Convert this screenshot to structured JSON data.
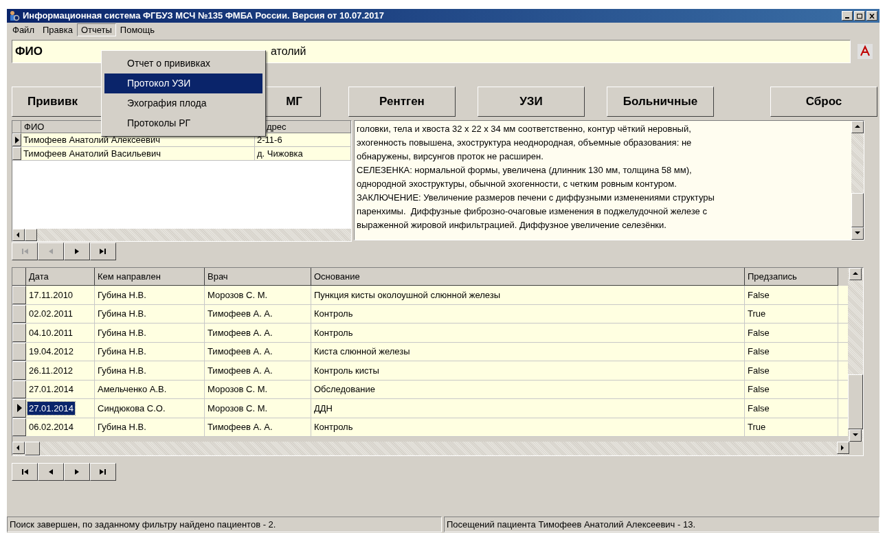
{
  "window": {
    "title": "Информационная система ФГБУЗ МСЧ №135 ФМБА России. Версия от 10.07.2017"
  },
  "menu": [
    {
      "label": "Файл",
      "selected": false
    },
    {
      "label": "Правка",
      "selected": false
    },
    {
      "label": "Отчеты",
      "selected": true
    },
    {
      "label": "Помощь",
      "selected": false
    }
  ],
  "dropdown": [
    {
      "label": "Отчет о прививках",
      "selected": false
    },
    {
      "label": "Протокол УЗИ",
      "selected": true
    },
    {
      "label": "Эхография плода",
      "selected": false
    },
    {
      "label": "Протоколы РГ",
      "selected": false
    }
  ],
  "search": {
    "label": "ФИО",
    "value": "атолий"
  },
  "buttons": [
    "Прививк",
    "МГ",
    "Рентген",
    "УЗИ",
    "Больничные",
    "Сброс"
  ],
  "patients": {
    "columns": [
      "ФИО",
      "дрес"
    ],
    "rows": [
      {
        "cells": [
          "Тимофеев Анатолий Алексеевич",
          "2-11-6"
        ],
        "selected": true
      },
      {
        "cells": [
          "Тимофеев Анатолий Васильевич",
          "д. Чижовка"
        ],
        "selected": false
      }
    ]
  },
  "patient_nav": [
    {
      "kind": "first",
      "disabled": true
    },
    {
      "kind": "prev",
      "disabled": true
    },
    {
      "kind": "next",
      "disabled": false
    },
    {
      "kind": "last",
      "disabled": false
    }
  ],
  "memo": {
    "lines": [
      "головки, тела и хвоста 32 х 22 х 34 мм соответственно, контур чёткий неровный,",
      "эхогенность повышена, эхоструктура неоднородная, объемные образования: не",
      "обнаружены, вирсунгов проток не расширен.",
      "СЕЛЕЗЕНКА: нормальной формы, увеличена (длинник 130 мм, толщина 58 мм),",
      "однородной эхоструктуры, обычной эхогенности, с четким ровным контуром.",
      "ЗАКЛЮЧЕНИЕ: Увеличение размеров печени с диффузными изменениями структуры",
      "паренхимы.  Диффузные фиброзно-очаговые изменения в поджелудочной железе с",
      "выраженной жировой инфильтрацией. Диффузное увеличение селезёнки."
    ]
  },
  "visits": {
    "columns": [
      "Дата",
      "Кем направлен",
      "Врач",
      "Основание",
      "Предзапись"
    ],
    "rows": [
      {
        "cells": [
          "17.11.2010",
          "Губина Н.В.",
          "Морозов С. М.",
          "Пункция кисты околоушной слюнной железы",
          "False"
        ],
        "selected": false
      },
      {
        "cells": [
          "02.02.2011",
          "Губина Н.В.",
          "Тимофеев А. А.",
          "Контроль",
          "True"
        ],
        "selected": false
      },
      {
        "cells": [
          "04.10.2011",
          "Губина Н.В.",
          "Тимофеев А. А.",
          "Контроль",
          "False"
        ],
        "selected": false
      },
      {
        "cells": [
          "19.04.2012",
          "Губина Н.В.",
          "Тимофеев А. А.",
          "Киста слюнной железы",
          "False"
        ],
        "selected": false
      },
      {
        "cells": [
          "26.11.2012",
          "Губина Н.В.",
          "Тимофеев А. А.",
          "Контроль кисты",
          "False"
        ],
        "selected": false
      },
      {
        "cells": [
          "27.01.2014",
          "Амельченко А.В.",
          "Морозов С. М.",
          "Обследование",
          "False"
        ],
        "selected": false
      },
      {
        "cells": [
          "27.01.2014",
          "Синдюкова С.О.",
          "Морозов С. М.",
          "ДДН",
          "False"
        ],
        "selected": true
      },
      {
        "cells": [
          "06.02.2014",
          "Губина Н.В.",
          "Тимофеев А. А.",
          "Контроль",
          "True"
        ],
        "selected": false
      }
    ]
  },
  "visit_nav": [
    {
      "kind": "first",
      "disabled": false
    },
    {
      "kind": "prev",
      "disabled": false
    },
    {
      "kind": "next",
      "disabled": false
    },
    {
      "kind": "last",
      "disabled": false
    }
  ],
  "status_bar": [
    "Поиск завершен, по заданному фильтру найдено пациентов - 2.",
    "Посещений пациента Тимофеев Анатолий Алексеевич - 13."
  ]
}
